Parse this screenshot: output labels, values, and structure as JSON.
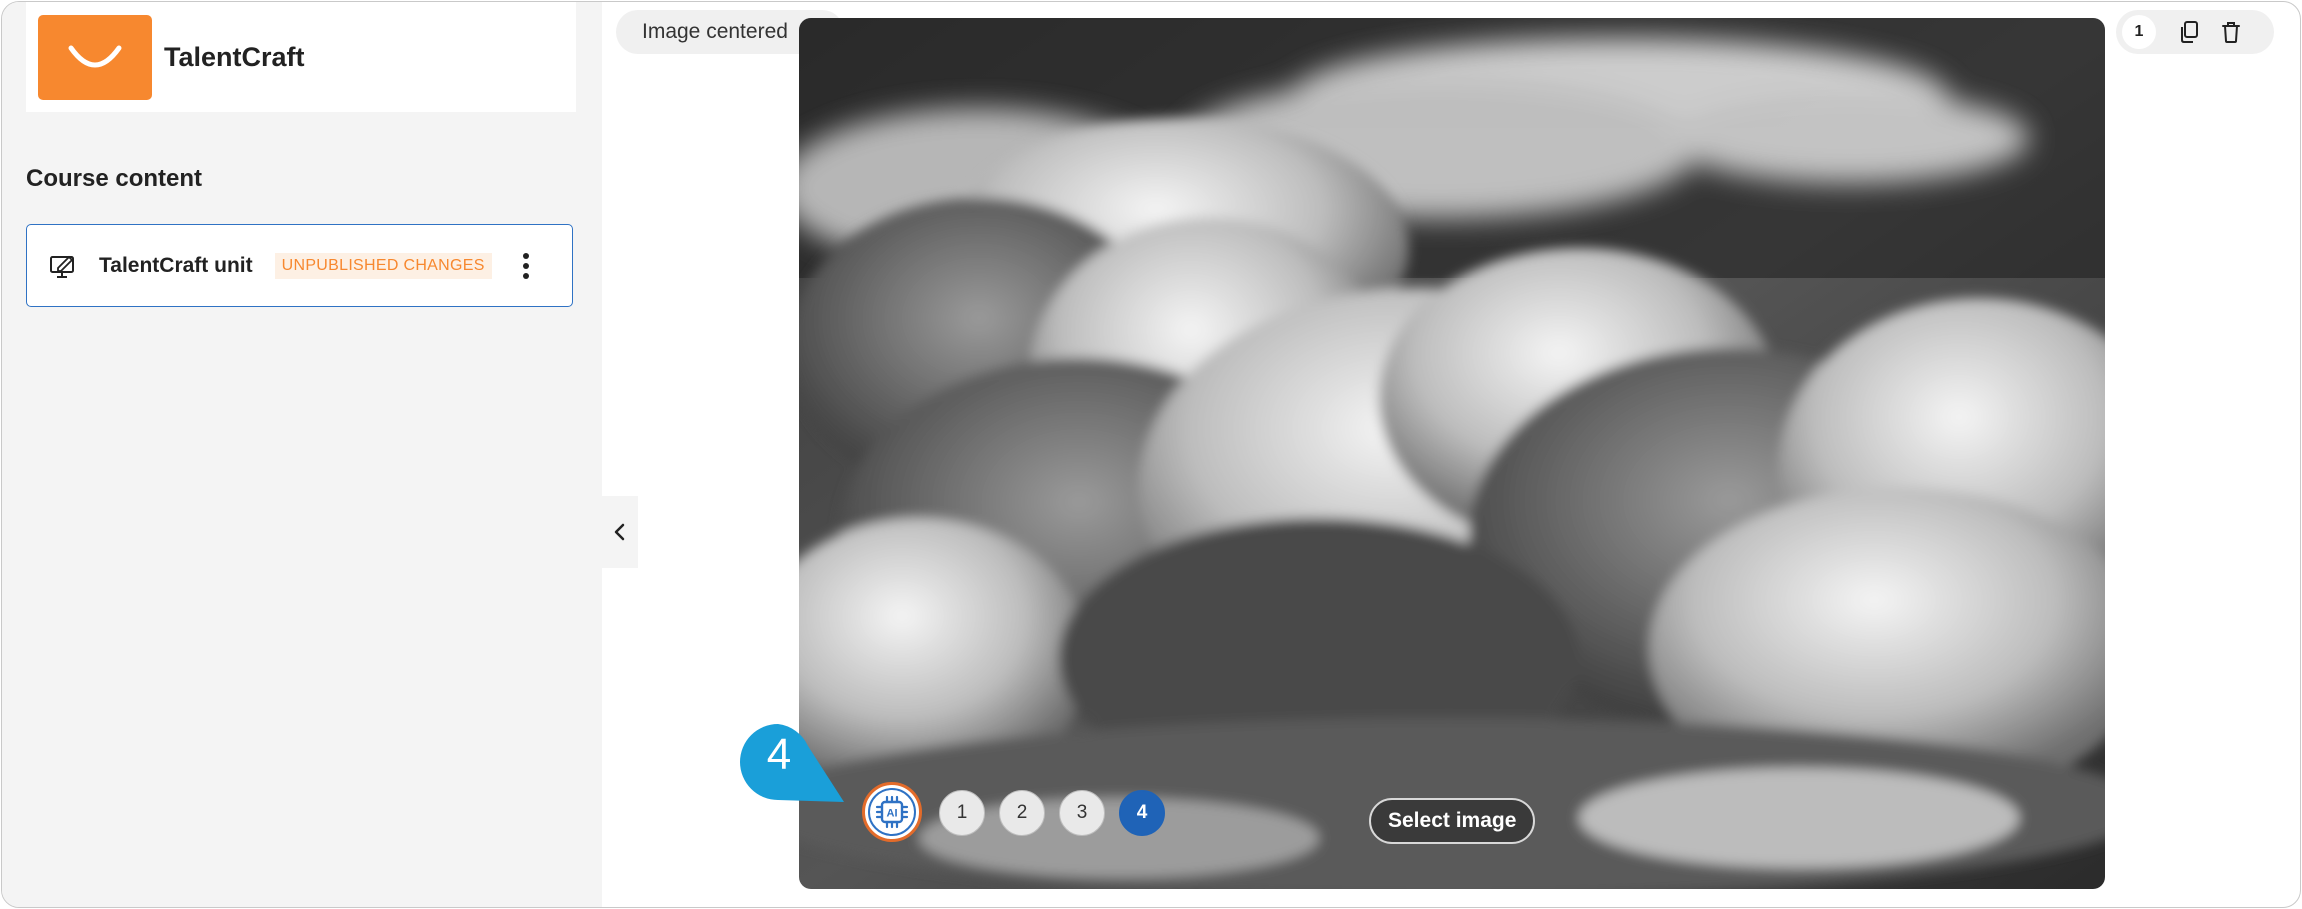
{
  "brand": {
    "name": "TalentCraft",
    "logo_icon": "smile-curve-icon"
  },
  "sidebar": {
    "section_title": "Course content",
    "unit": {
      "title": "TalentCraft unit",
      "badge": "UNPUBLISHED CHANGES",
      "icon": "monitor-edit-icon"
    }
  },
  "main": {
    "layout_select": {
      "label": "Image centered"
    },
    "toolbar": {
      "page_number": "1"
    },
    "image_picker": {
      "options": [
        "1",
        "2",
        "3",
        "4"
      ],
      "active": "4",
      "select_label": "Select image"
    },
    "callout": {
      "number": "4"
    }
  },
  "colors": {
    "accent": "#f7882f",
    "primary": "#1f63b7",
    "callout": "#1a9fd9"
  }
}
